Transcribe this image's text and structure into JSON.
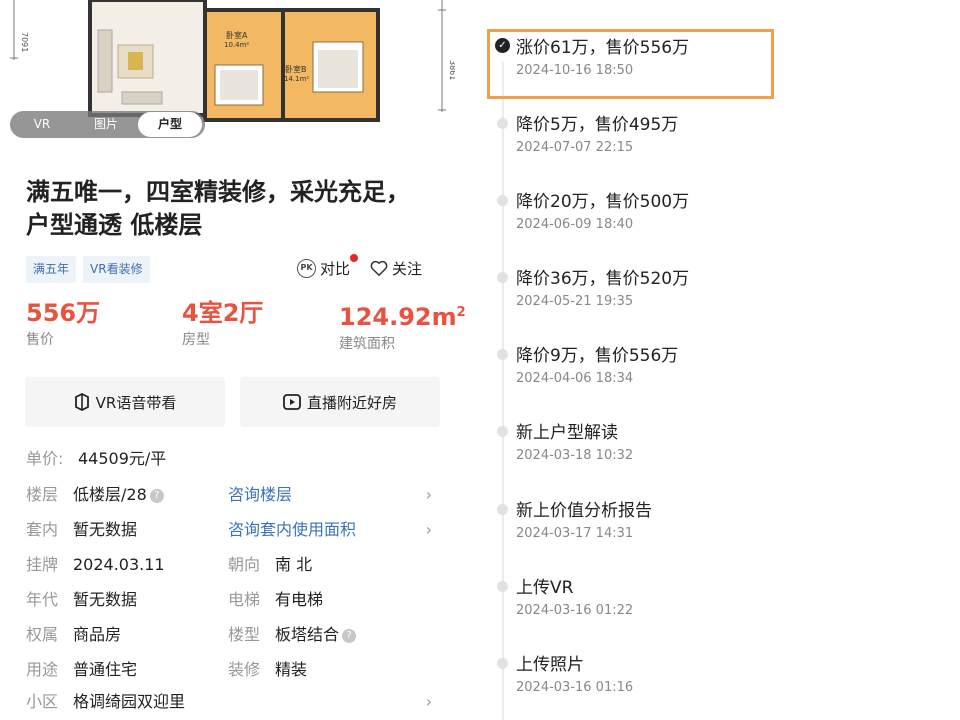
{
  "floorplan": {
    "room_a_name": "卧室A",
    "room_a_area": "10.4m²",
    "room_b_name": "卧室B",
    "room_b_area": "14.1m²",
    "dim_left": "7091",
    "dim_right": "3861"
  },
  "media_tabs": [
    {
      "label": "VR"
    },
    {
      "label": "图片"
    },
    {
      "label": "户型",
      "active": true
    }
  ],
  "listing": {
    "title": "满五唯一，四室精装修，采光充足，户型通透 低楼层",
    "tags": [
      "满五年",
      "VR看装修"
    ],
    "compare_label": "对比",
    "follow_label": "关注"
  },
  "stats": {
    "price_value": "556万",
    "price_label": "售价",
    "layout_value": "4室2厅",
    "layout_label": "房型",
    "area_value": "124.92m",
    "area_sup": "2",
    "area_label": "建筑面积"
  },
  "buttons": {
    "vr_tour": "VR语音带看",
    "live_nearby": "直播附近好房"
  },
  "details": {
    "unit_price_key": "单价:",
    "unit_price_val": "44509元/平",
    "floor_key": "楼层",
    "floor_val": "低楼层/28",
    "floor_link": "咨询楼层",
    "inner_key": "套内",
    "inner_val": "暂无数据",
    "inner_link": "咨询套内使用面积",
    "listed_key": "挂牌",
    "listed_val": "2024.03.11",
    "orient_key": "朝向",
    "orient_val": "南 北",
    "year_key": "年代",
    "year_val": "暂无数据",
    "elevator_key": "电梯",
    "elevator_val": "有电梯",
    "rights_key": "权属",
    "rights_val": "商品房",
    "building_key": "楼型",
    "building_val": "板塔结合",
    "use_key": "用途",
    "use_val": "普通住宅",
    "decor_key": "装修",
    "decor_val": "精装",
    "community_key": "小区",
    "community_val": "格调绮园双迎里"
  },
  "timeline": [
    {
      "title": "涨价61万，售价556万",
      "date": "2024-10-16 18:50",
      "current": true
    },
    {
      "title": "降价5万，售价495万",
      "date": "2024-07-07 22:15"
    },
    {
      "title": "降价20万，售价500万",
      "date": "2024-06-09 18:40"
    },
    {
      "title": "降价36万，售价520万",
      "date": "2024-05-21 19:35"
    },
    {
      "title": "降价9万，售价556万",
      "date": "2024-04-06 18:34"
    },
    {
      "title": "新上户型解读",
      "date": "2024-03-18 10:32"
    },
    {
      "title": "新上价值分析报告",
      "date": "2024-03-17 14:31"
    },
    {
      "title": "上传VR",
      "date": "2024-03-16 01:22"
    },
    {
      "title": "上传照片",
      "date": "2024-03-16 01:16"
    }
  ],
  "colors": {
    "accent_price": "#e8523f",
    "link_blue": "#3b73b9",
    "highlight_border": "#f0a04b"
  }
}
